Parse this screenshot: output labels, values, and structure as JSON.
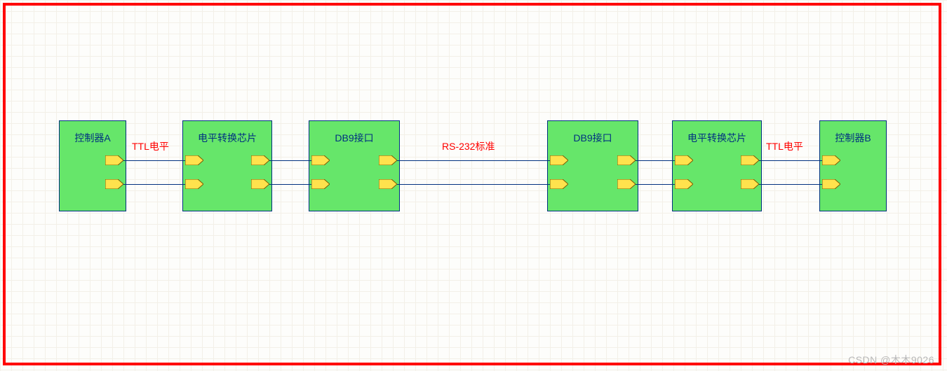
{
  "blocks": {
    "ctrlA": {
      "title": "控制器A"
    },
    "convL": {
      "title": "电平转换芯片"
    },
    "db9L": {
      "title": "DB9接口"
    },
    "db9R": {
      "title": "DB9接口"
    },
    "convR": {
      "title": "电平转换芯片"
    },
    "ctrlB": {
      "title": "控制器B"
    }
  },
  "links": {
    "ttlL": {
      "label": "TTL电平"
    },
    "rs232": {
      "label": "RS-232标准"
    },
    "ttlR": {
      "label": "TTL电平"
    }
  },
  "watermark": "CSDN @木木9026"
}
